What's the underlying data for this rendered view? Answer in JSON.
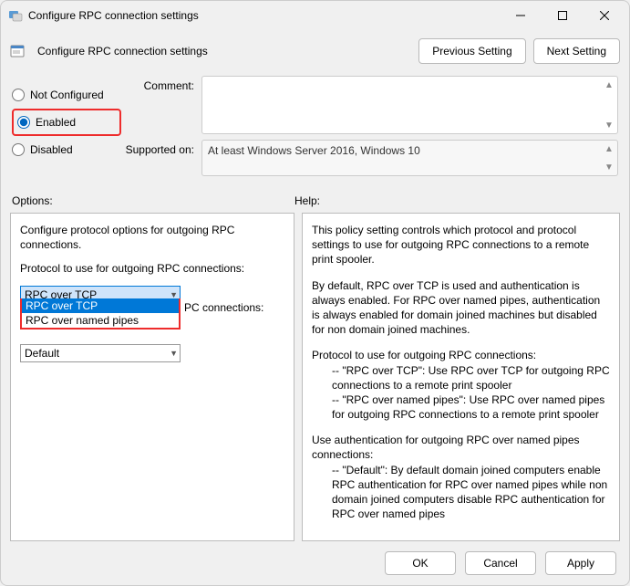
{
  "titlebar": {
    "title": "Configure RPC connection settings"
  },
  "subheader": {
    "title": "Configure RPC connection settings",
    "prev": "Previous Setting",
    "next": "Next Setting"
  },
  "state": {
    "not_configured": "Not Configured",
    "enabled": "Enabled",
    "disabled": "Disabled"
  },
  "meta": {
    "comment_label": "Comment:",
    "supported_label": "Supported on:",
    "supported_value": "At least Windows Server 2016, Windows 10"
  },
  "labels": {
    "options": "Options:",
    "help": "Help:"
  },
  "options": {
    "desc": "Configure protocol options for outgoing RPC connections.",
    "protocol_label": "Protocol to use for outgoing RPC connections:",
    "protocol_value": "RPC over TCP",
    "dropdown_opt1": "RPC over TCP",
    "dropdown_opt2": "RPC over named pipes",
    "conn_suffix": "PC connections:",
    "auth_value": "Default"
  },
  "help": {
    "p1": "This policy setting controls which protocol and protocol settings to use for outgoing RPC connections to a remote print spooler.",
    "p2": "By default, RPC over TCP is used and authentication is always enabled. For RPC over named pipes, authentication is always enabled for domain joined machines but disabled for non domain joined machines.",
    "p3": "Protocol to use for outgoing RPC connections:",
    "p3a": "-- \"RPC over TCP\": Use RPC over TCP for outgoing RPC connections to a remote print spooler",
    "p3b": "-- \"RPC over named pipes\": Use RPC over named pipes for outgoing RPC connections to a remote print spooler",
    "p4": "Use authentication for outgoing RPC over named pipes connections:",
    "p4a": "-- \"Default\": By default domain joined computers enable RPC authentication for RPC over named pipes while non domain joined computers disable RPC authentication for RPC over named pipes"
  },
  "footer": {
    "ok": "OK",
    "cancel": "Cancel",
    "apply": "Apply"
  }
}
